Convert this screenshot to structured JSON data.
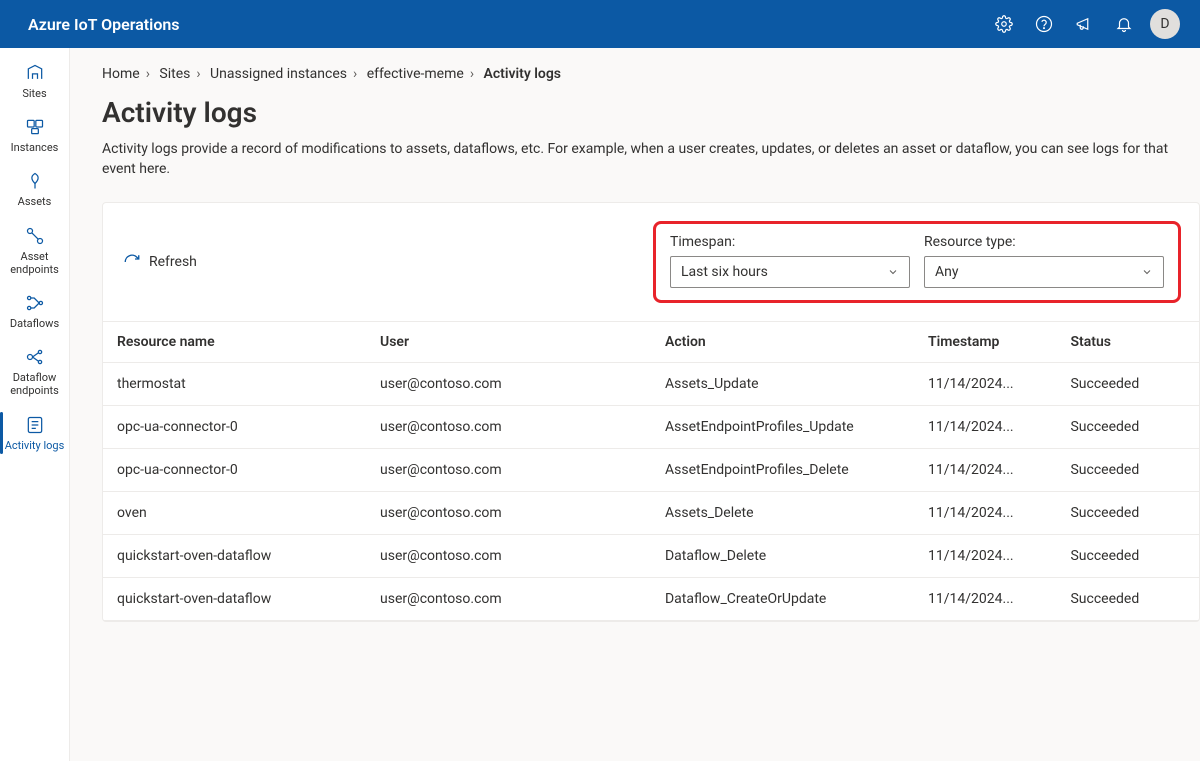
{
  "header": {
    "product": "Azure IoT Operations",
    "avatar": "D"
  },
  "sidebar": {
    "items": [
      {
        "label": "Sites"
      },
      {
        "label": "Instances"
      },
      {
        "label": "Assets"
      },
      {
        "label": "Asset endpoints"
      },
      {
        "label": "Dataflows"
      },
      {
        "label": "Dataflow endpoints"
      },
      {
        "label": "Activity logs"
      }
    ]
  },
  "breadcrumbs": {
    "items": [
      "Home",
      "Sites",
      "Unassigned instances",
      "effective-meme"
    ],
    "current": "Activity logs"
  },
  "page": {
    "title": "Activity logs",
    "description": "Activity logs provide a record of modifications to assets, dataflows, etc. For example, when a user creates, updates, or deletes an asset or dataflow, you can see logs for that event here."
  },
  "toolbar": {
    "refresh": "Refresh"
  },
  "filters": {
    "timespan": {
      "label": "Timespan:",
      "value": "Last six hours"
    },
    "resourceType": {
      "label": "Resource type:",
      "value": "Any"
    }
  },
  "table": {
    "columns": [
      "Resource name",
      "User",
      "Action",
      "Timestamp",
      "Status"
    ],
    "rows": [
      {
        "name": "thermostat",
        "user": "user@contoso.com",
        "action": "Assets_Update",
        "ts": "11/14/2024...",
        "status": "Succeeded"
      },
      {
        "name": "opc-ua-connector-0",
        "user": "user@contoso.com",
        "action": "AssetEndpointProfiles_Update",
        "ts": "11/14/2024...",
        "status": "Succeeded"
      },
      {
        "name": "opc-ua-connector-0",
        "user": "user@contoso.com",
        "action": "AssetEndpointProfiles_Delete",
        "ts": "11/14/2024...",
        "status": "Succeeded"
      },
      {
        "name": "oven",
        "user": "user@contoso.com",
        "action": "Assets_Delete",
        "ts": "11/14/2024...",
        "status": "Succeeded"
      },
      {
        "name": "quickstart-oven-dataflow",
        "user": "user@contoso.com",
        "action": "Dataflow_Delete",
        "ts": "11/14/2024...",
        "status": "Succeeded"
      },
      {
        "name": "quickstart-oven-dataflow",
        "user": "user@contoso.com",
        "action": "Dataflow_CreateOrUpdate",
        "ts": "11/14/2024...",
        "status": "Succeeded"
      }
    ]
  }
}
